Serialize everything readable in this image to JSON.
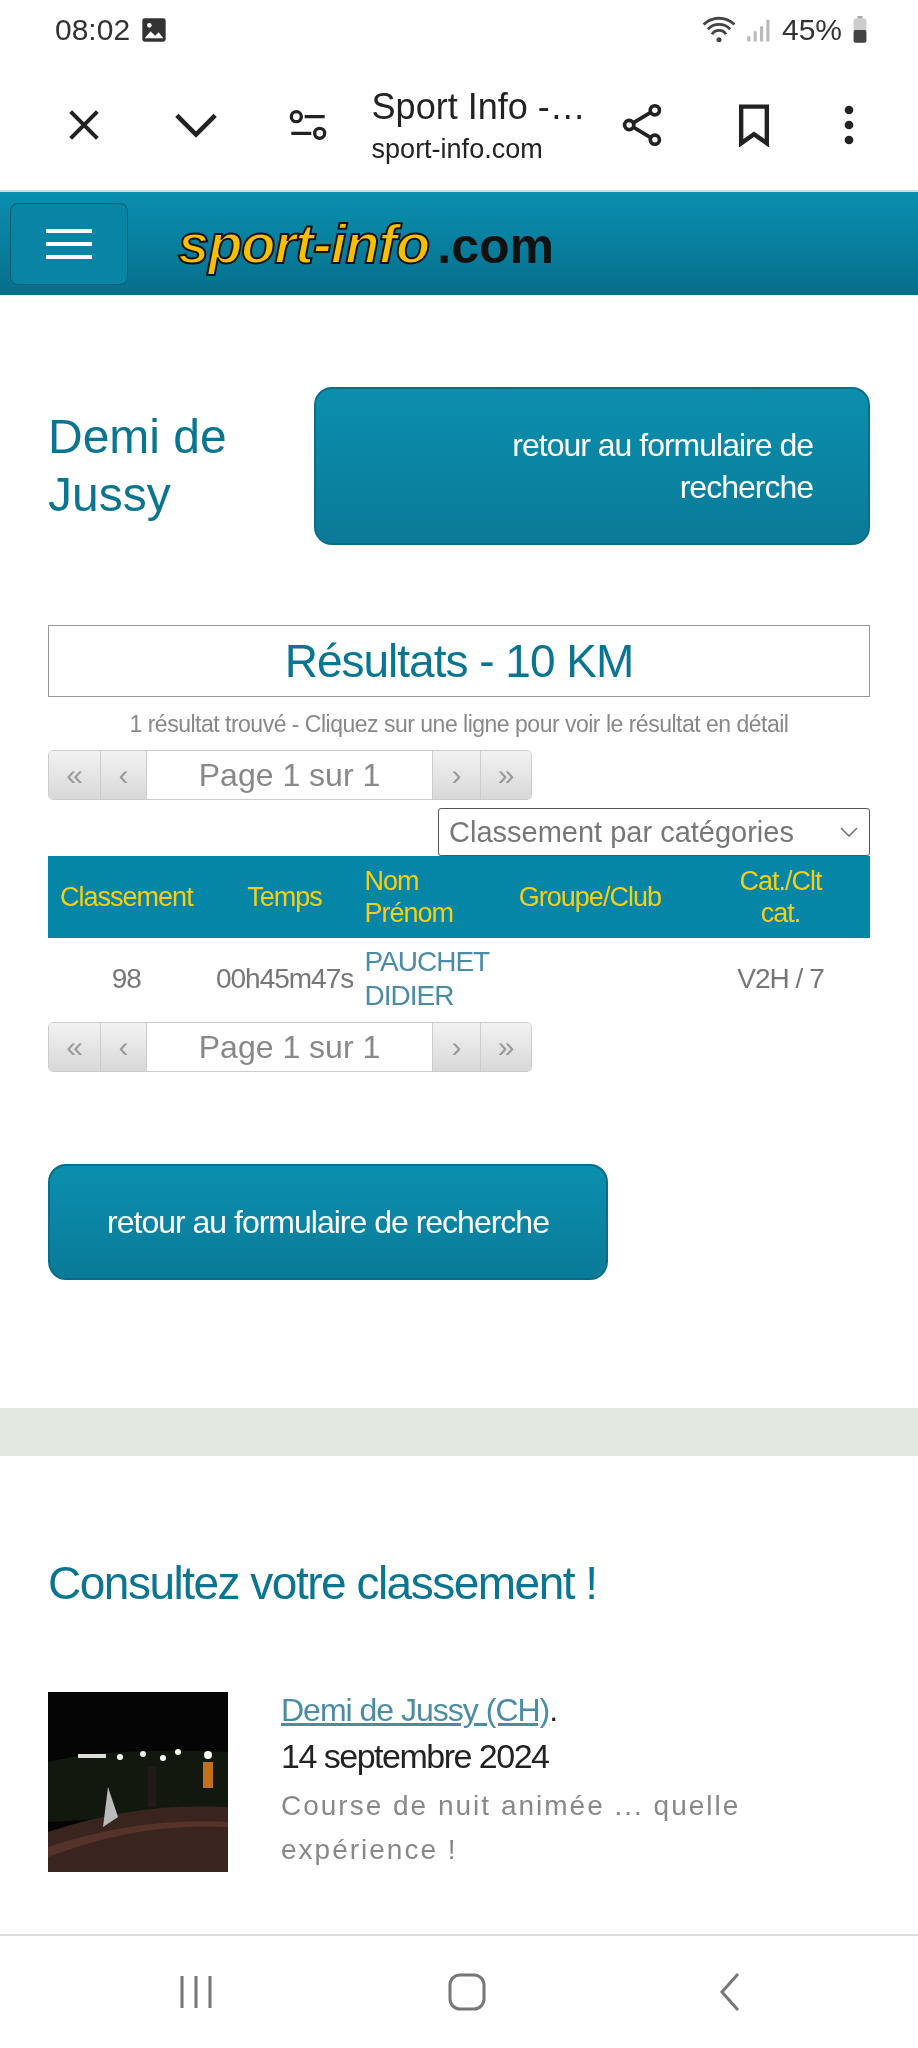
{
  "status_bar": {
    "time": "08:02",
    "battery": "45%"
  },
  "browser": {
    "title": "Sport Info -…",
    "url": "sport-info.com"
  },
  "site_header": {
    "logo": "sport-info",
    "logo_suffix": ".com"
  },
  "event_title": "Demi de Jussy",
  "back_button_top": "retour au formulaire de recherche",
  "results": {
    "title": "Résultats - 10 KM",
    "summary": "1 résultat trouvé - Cliquez sur une ligne pour voir le résultat en détail",
    "pager": {
      "first": "«",
      "prev": "‹",
      "page": "Page 1 sur 1",
      "next": "›",
      "last": "»"
    },
    "ranking_select": {
      "value": "Classement par catégories"
    },
    "table": {
      "columns": [
        "Classement",
        "Temps",
        "Nom Prénom",
        "Groupe/Club",
        "Cat./Clt cat."
      ],
      "rows": [
        {
          "classement": "98",
          "temps": "00h45m47s",
          "nom_prenom": "PAUCHET DIDIER",
          "categorie": "V2H / 7"
        }
      ]
    },
    "pager_bottom": {
      "first": "«",
      "prev": "‹",
      "page": "Page 1 sur 1",
      "next": "›",
      "last": "»"
    }
  },
  "back_button_bottom": "retour au formulaire de recherche",
  "promo": {
    "heading": "Consultez votre classement !",
    "item": {
      "kind": "picture",
      "link": "Demi de Jussy (CH)",
      "link_suffix": ".",
      "date": "14 septembre 2024",
      "description": "Course de nuit animée ... quelle expérience !"
    }
  }
}
